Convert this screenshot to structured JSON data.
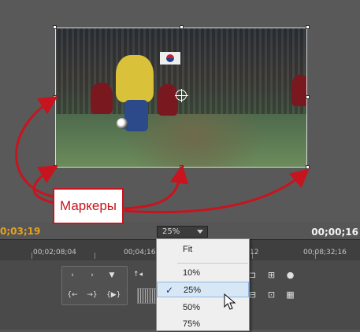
{
  "callout": {
    "label": "Маркеры"
  },
  "timecodes": {
    "current": "0;03;19",
    "duration": "00;00;16"
  },
  "zoom": {
    "selected": "25%",
    "options": [
      "Fit",
      "10%",
      "25%",
      "50%",
      "75%"
    ],
    "checked": "25%"
  },
  "ruler": {
    "labels": [
      "00;02;08;04",
      "00;04;16",
      "12",
      "00;08;32;16"
    ]
  },
  "colors": {
    "accent_red": "#c8141e",
    "timecode_current": "#e8a11c"
  },
  "icons": {
    "check": "✓"
  }
}
